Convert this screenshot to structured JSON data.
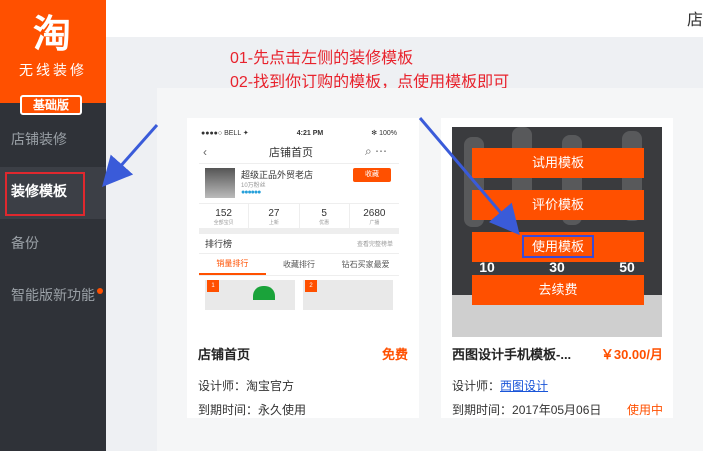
{
  "brand": {
    "logo_char": "淘",
    "subtitle": "无线装修",
    "badge": "基础版"
  },
  "sidebar": {
    "items": [
      {
        "label": "店铺装修"
      },
      {
        "label": "装修模板"
      },
      {
        "label": "备份"
      },
      {
        "label": "智能版新功能"
      }
    ]
  },
  "topbar": {
    "text": "店"
  },
  "instructions": {
    "line1": "01-先点击左侧的装修模板",
    "line2": "02-找到你订购的模板，点使用模板即可"
  },
  "card1": {
    "phone": {
      "carrier": "●●●●○ BELL ✦",
      "time": "4:21 PM",
      "battery": "✻ 100%",
      "header": "店铺首页",
      "shop_name": "超级正品外贸老店",
      "fans": "10万粉丝",
      "rating_dots": "●●●●●●",
      "fav_button": "收藏",
      "stats": [
        {
          "n": "152",
          "l": "全部宝贝"
        },
        {
          "n": "27",
          "l": "上新"
        },
        {
          "n": "5",
          "l": "优惠"
        },
        {
          "n": "2680",
          "l": "广播"
        }
      ],
      "rank_title": "排行榜",
      "rank_more": "查看完整榜单",
      "rank_tabs": [
        "销量排行",
        "收藏排行",
        "钻石买家最爱"
      ],
      "prod_ranks": [
        "1",
        "2"
      ]
    },
    "title": "店铺首页",
    "price": "免费",
    "designer_label": "设计师：",
    "designer": "淘宝官方",
    "expiry_label": "到期时间：",
    "expiry": "永久使用"
  },
  "card2": {
    "buttons": [
      "试用模板",
      "评价模板",
      "使用模板",
      "去续费"
    ],
    "preview_nums": [
      "10",
      "30",
      "50"
    ],
    "title": "西图设计手机模板-...",
    "price": "￥30.00/月",
    "designer_label": "设计师：",
    "designer": "西图设计",
    "expiry_label": "到期时间：",
    "expiry": "2017年05月06日",
    "status": "使用中"
  },
  "colors": {
    "brand": "#ff5000",
    "sidebar": "#2f3238",
    "annotation": "#e8232d",
    "arrow": "#3a5bd9"
  }
}
